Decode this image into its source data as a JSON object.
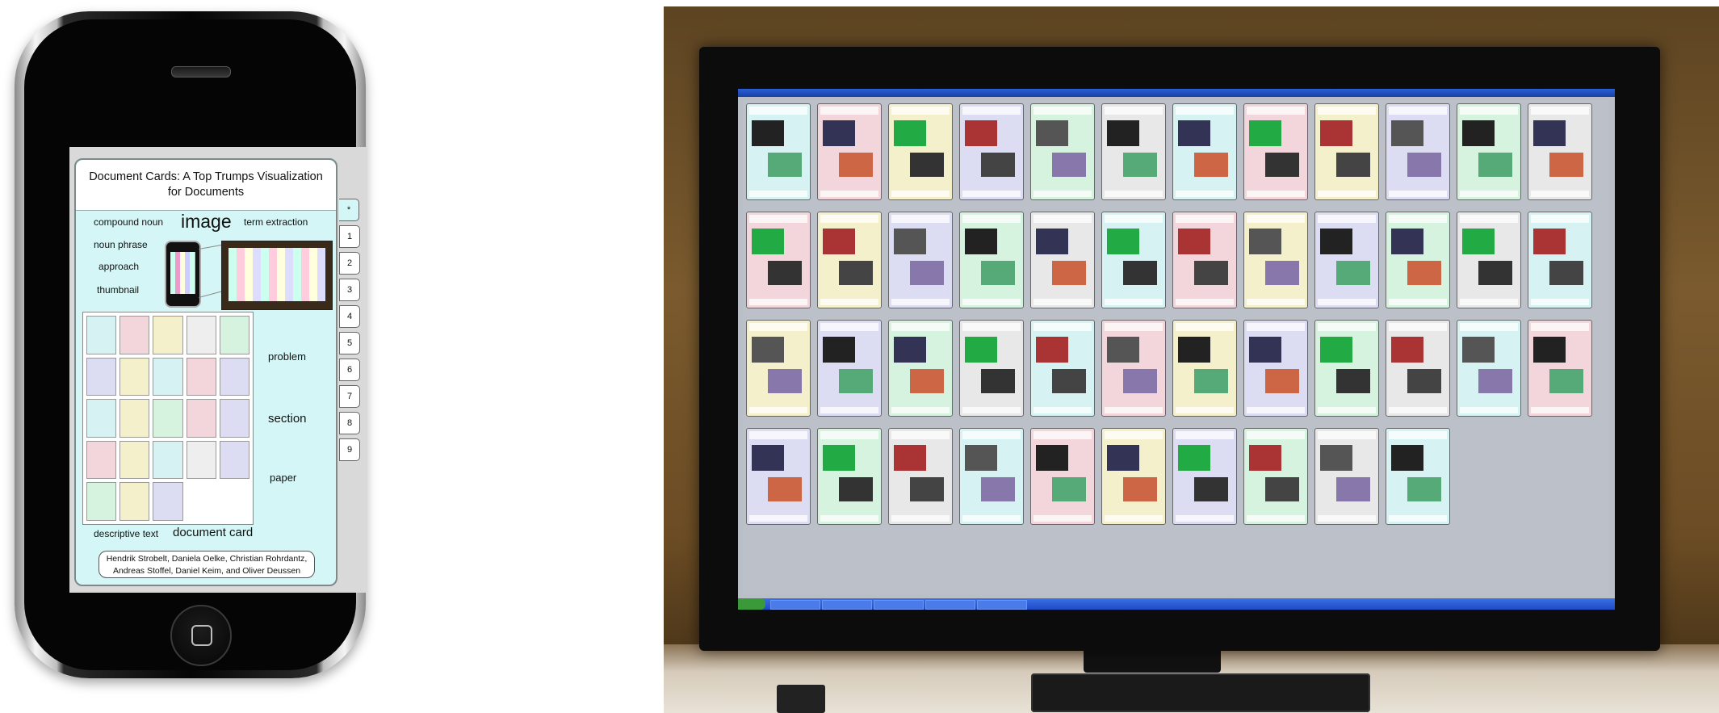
{
  "phone": {
    "card_title": "Document Cards: A Top Trumps Visualization for Documents",
    "keywords": {
      "compound_noun": "compound noun",
      "image": "image",
      "term_extraction": "term extraction",
      "noun_phrase": "noun phrase",
      "approach": "approach",
      "thumbnail": "thumbnail",
      "problem": "problem",
      "section": "section",
      "paper": "paper",
      "descriptive_text": "descriptive text",
      "document_card": "document card"
    },
    "authors_line1": "Hendrik Strobelt, Daniela Oelke, Christian Rohrdantz,",
    "authors_line2": "Andreas Stoffel, Daniel Keim, and Oliver Deussen",
    "tabs": [
      "*",
      "1",
      "2",
      "3",
      "4",
      "5",
      "6",
      "7",
      "8",
      "9"
    ],
    "accent_color": "#d4f6f6"
  },
  "monitor": {
    "card_colors": [
      "#d6f2f2",
      "#f3d6dc",
      "#f5f0cc",
      "#dcdcf3",
      "#d6f3e0",
      "#e8e8e8"
    ]
  }
}
